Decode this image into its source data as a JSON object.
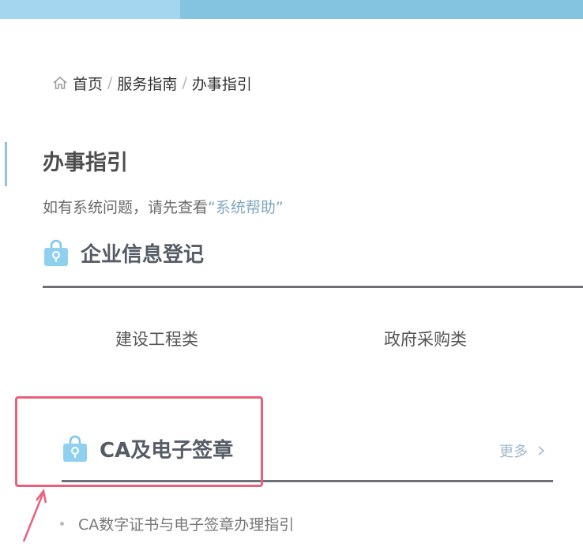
{
  "breadcrumb": {
    "icon": "home-icon",
    "items": [
      "首页",
      "服务指南",
      "办事指引"
    ],
    "separator": "/"
  },
  "page": {
    "title": "办事指引",
    "help_prefix": "如有系统问题，请先查看",
    "help_link": "“系统帮助”"
  },
  "section_enterprise": {
    "icon": "bag-icon",
    "title": "企业信息登记",
    "categories": [
      "建设工程类",
      "政府采购类"
    ]
  },
  "section_ca": {
    "icon": "bag-icon",
    "title": "CA及电子签章",
    "more_label": "更多",
    "items": [
      "CA数字证书与电子签章办理指引"
    ]
  },
  "colors": {
    "accent_blue": "#84c4e0",
    "highlight_red": "#e8607a",
    "link_blue": "#7fa7bf",
    "rule_gray": "#6e6e77"
  }
}
